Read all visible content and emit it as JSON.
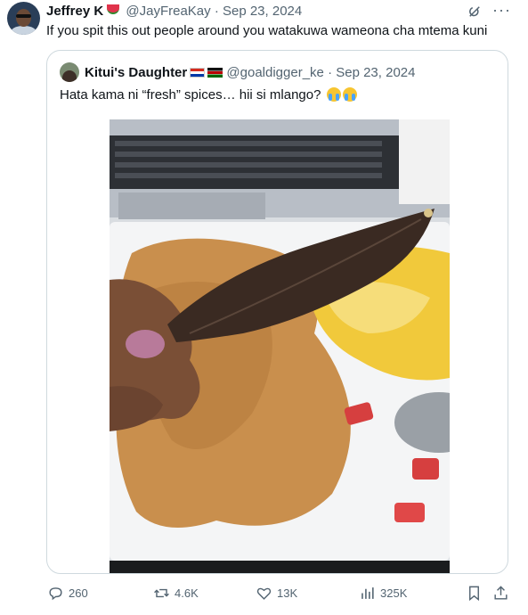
{
  "tweet": {
    "author_name": "Jeffrey K",
    "author_handle": "@JayFreaKay",
    "separator": "·",
    "date": "Sep 23, 2024",
    "text": "If you spit this out people around you watakuwa wameona cha mtema kuni"
  },
  "quote": {
    "author_name": "Kitui's Daughter",
    "author_handle": "@goaldigger_ke",
    "separator": "·",
    "date": "Sep 23, 2024",
    "text": "Hata kama ni “fresh” spices… hii si mlango?"
  },
  "actions": {
    "replies": "260",
    "reposts": "4.6K",
    "likes": "13K",
    "views": "325K"
  },
  "icons": {
    "author_emoji": "watermelon",
    "quote_flags": [
      "paraguay-flag",
      "kenya-flag"
    ],
    "quote_emoji": [
      "loudly-crying-face",
      "loudly-crying-face"
    ]
  },
  "colors": {
    "text": "#0f1419",
    "muted": "#536471",
    "border": "#cfd9de"
  }
}
